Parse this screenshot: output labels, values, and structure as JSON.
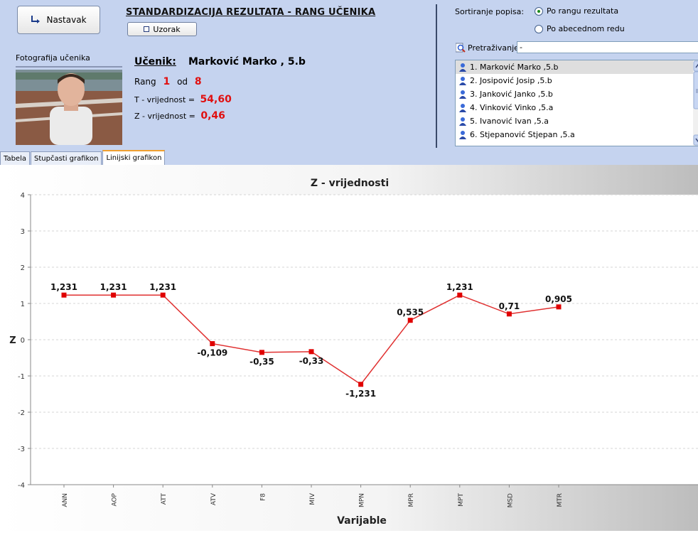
{
  "header": {
    "nastavak_label": "Nastavak",
    "title": "STANDARDIZACIJA REZULTATA - RANG UČENIKA",
    "uzorak_label": "Uzorak"
  },
  "student": {
    "photo_label": "Fotografija učenika",
    "ucenik_label": "Učenik:",
    "ucenik_value": "Marković Marko , 5.b",
    "rang_label": "Rang",
    "rang_value": "1",
    "od_label": "od",
    "total_value": "8",
    "t_label": "T - vrijednost =",
    "t_value": "54,60",
    "z_label": "Z - vrijednost =",
    "z_value": "0,46"
  },
  "sort": {
    "label": "Sortiranje popisa:",
    "options": [
      {
        "label": "Po rangu rezultata",
        "selected": true
      },
      {
        "label": "Po abecednom redu",
        "selected": false
      }
    ]
  },
  "search": {
    "label": "Pretraživanje:",
    "value": "-"
  },
  "student_list": [
    "1. Marković Marko ,5.b",
    "2. Josipović Josip ,5.b",
    "3. Janković Janko ,5.b",
    "4. Vinković Vinko ,5.a",
    "5. Ivanović Ivan ,5.a",
    "6. Stjepanović Stjepan ,5.a"
  ],
  "tabs": [
    {
      "label": "Tabela",
      "active": false
    },
    {
      "label": "Stupčasti grafikon",
      "active": false
    },
    {
      "label": "Linijski grafikon",
      "active": true
    }
  ],
  "colors": {
    "line": "#e03030",
    "marker": "#e00000",
    "header_bg": "#c5d3ef",
    "accent_red": "#e01010"
  },
  "chart_data": {
    "type": "line",
    "title": "Z - vrijednosti",
    "xlabel": "Varijable",
    "ylabel": "Z",
    "ylim": [
      -4,
      4
    ],
    "yticks": [
      "4",
      "3",
      "2",
      "1",
      "0",
      "-1",
      "-2",
      "-3",
      "-4"
    ],
    "grid": true,
    "categories": [
      "ANN",
      "AOP",
      "ATT",
      "ATV",
      "F8",
      "MIV",
      "MPN",
      "MPR",
      "MPT",
      "MSD",
      "MTR"
    ],
    "values": [
      1.231,
      1.231,
      1.231,
      -0.109,
      -0.35,
      -0.33,
      -1.231,
      0.535,
      1.231,
      0.71,
      0.905
    ],
    "value_labels": [
      "1,231",
      "1,231",
      "1,231",
      "-0,109",
      "-0,35",
      "-0,33",
      "-1,231",
      "0,535",
      "1,231",
      "0,71",
      "0,905"
    ]
  }
}
